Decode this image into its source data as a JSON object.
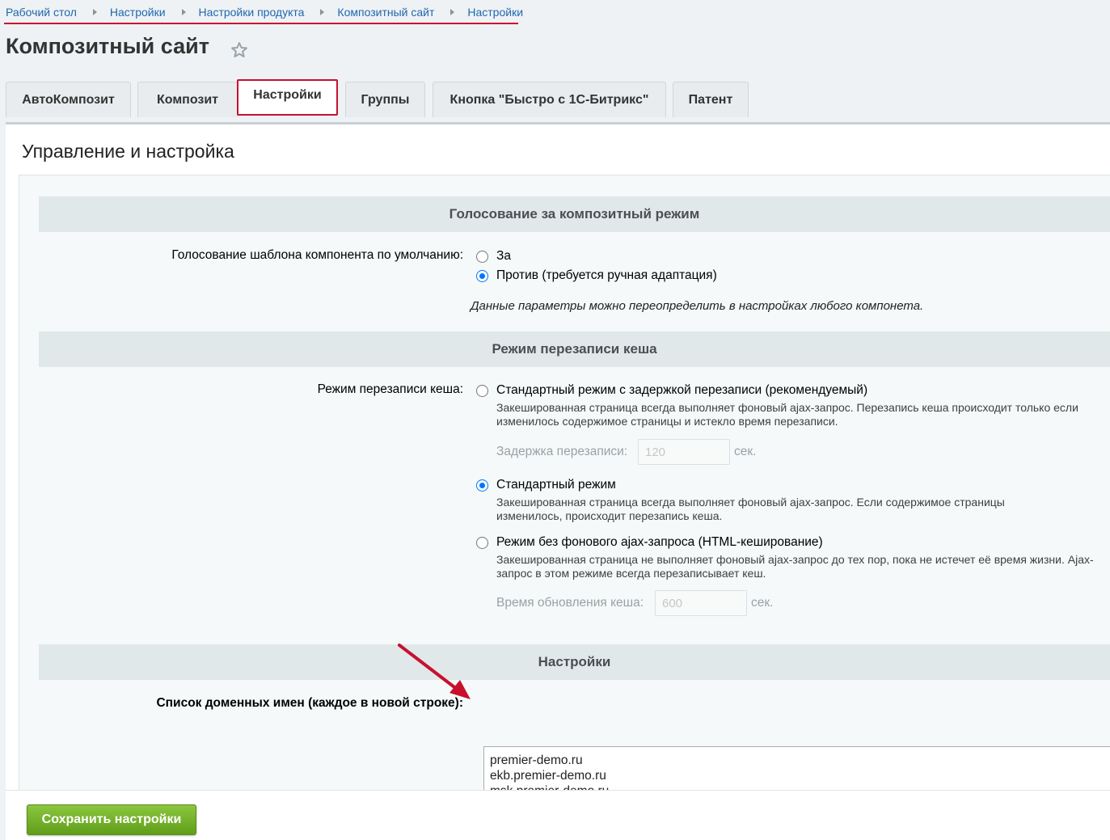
{
  "breadcrumb": [
    "Рабочий стол",
    "Настройки",
    "Настройки продукта",
    "Композитный сайт",
    "Настройки"
  ],
  "page_title": "Композитный сайт",
  "tabs": [
    "АвтоКомпозит",
    "Композит",
    "Настройки",
    "Группы",
    "Кнопка \"Быстро с 1С-Битрикс\"",
    "Патент"
  ],
  "active_tab": "Настройки",
  "panel_heading": "Управление и настройка",
  "voting": {
    "header": "Голосование за композитный режим",
    "label": "Голосование шаблона компонента по умолчанию:",
    "options": [
      "За",
      "Против (требуется ручная адаптация)"
    ],
    "selected": "Против (требуется ручная адаптация)",
    "note": "Данные параметры можно переопределить в настройках любого компонета."
  },
  "cache": {
    "header": "Режим перезаписи кеша",
    "label": "Режим перезаписи кеша:",
    "options": [
      {
        "label": "Стандартный режим с задержкой перезаписи (рекомендуемый)",
        "desc": "Закешированная страница всегда выполняет фоновый ajax-запрос. Перезапись кеша происходит только если изменилось содержимое страницы и истекло время перезаписи."
      },
      {
        "label": "Стандартный режим",
        "desc": "Закешированная страница всегда выполняет фоновый ajax-запрос. Если содержимое страницы изменилось, происходит перезапись кеша."
      },
      {
        "label": "Режим без фонового ajax-запроса (HTML-кеширование)",
        "desc": "Закешированная страница не выполняет фоновый ajax-запрос до тех пор, пока не истечет её время жизни. Ajax-запрос в этом режиме всегда перезаписывает кеш."
      }
    ],
    "selected": "Стандартный режим",
    "delay_label": "Задержка перезаписи:",
    "delay_value": "120",
    "delay_unit": "сек.",
    "refresh_label": "Время обновления кеша:",
    "refresh_value": "600",
    "refresh_unit": "сек."
  },
  "settings": {
    "header": "Настройки",
    "domains_label": "Список доменных имен (каждое в новой строке):",
    "domains": "premier-demo.ru\nekb.premier-demo.ru\nmsk.premier-demo.ru"
  },
  "save_label": "Сохранить настройки",
  "colors": {
    "highlight": "#c8102e",
    "link": "#2067b0",
    "save_green": "#6ab023",
    "radio_checked": "#0075ff"
  }
}
